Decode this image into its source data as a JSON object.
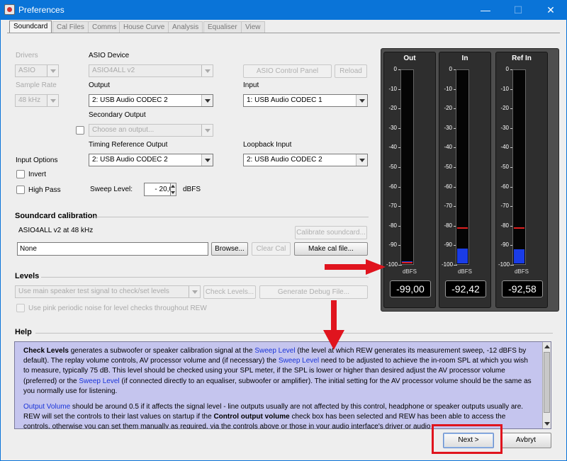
{
  "window": {
    "title": "Preferences",
    "minimize": "—",
    "maximize": "☐",
    "close": "✕"
  },
  "tabs": [
    "Soundcard",
    "Cal Files",
    "Comms",
    "House Curve",
    "Analysis",
    "Equaliser",
    "View"
  ],
  "drivers": {
    "label": "Drivers",
    "value": "ASIO"
  },
  "sample_rate": {
    "label": "Sample Rate",
    "value": "48 kHz"
  },
  "asio_device": {
    "label": "ASIO Device",
    "value": "ASIO4ALL v2"
  },
  "asio_control_panel": "ASIO Control Panel",
  "reload": "Reload",
  "output": {
    "label": "Output",
    "value": "2: USB Audio CODEC  2"
  },
  "input": {
    "label": "Input",
    "value": "1: USB Audio CODEC  1"
  },
  "secondary_output": {
    "label": "Secondary Output",
    "placeholder": "Choose an output..."
  },
  "timing_ref": {
    "label": "Timing Reference Output",
    "value": "2: USB Audio CODEC  2"
  },
  "loopback": {
    "label": "Loopback Input",
    "value": "2: USB Audio CODEC  2"
  },
  "input_options": {
    "label": "Input Options",
    "invert": "Invert",
    "high_pass": "High Pass"
  },
  "sweep": {
    "label": "Sweep Level:",
    "value": "- 20,0",
    "unit": "dBFS"
  },
  "calibration": {
    "title": "Soundcard calibration",
    "info": "ASIO4ALL v2 at 48 kHz",
    "calibrate": "Calibrate soundcard...",
    "file": "None",
    "browse": "Browse...",
    "clear": "Clear Cal",
    "make": "Make cal file..."
  },
  "levels": {
    "title": "Levels",
    "signal": "Use main speaker test signal to check/set levels",
    "check": "Check Levels...",
    "debug": "Generate Debug File...",
    "pink": "Use pink periodic noise for level checks throughout REW"
  },
  "meters": [
    {
      "title": "Out",
      "value": "-99,00",
      "peak_db": -99,
      "level_db": -99,
      "unit": "dBFS"
    },
    {
      "title": "In",
      "value": "-92,42",
      "peak_db": -81,
      "level_db": -92.42,
      "unit": "dBFS"
    },
    {
      "title": "Ref In",
      "value": "-92,58",
      "peak_db": -81,
      "level_db": -92.58,
      "unit": "dBFS"
    }
  ],
  "scale_ticks": [
    "0",
    "-10",
    "-20",
    "-30",
    "-40",
    "-50",
    "-60",
    "-70",
    "-80",
    "-90",
    "-100"
  ],
  "help": {
    "title": "Help",
    "p1": {
      "b1": "Check Levels",
      "t1": " generates a subwoofer or speaker calibration signal at the ",
      "l1": "Sweep Level",
      "t2": " (the level at which REW generates its measurement sweep, -12 dBFS by default). The replay volume controls, AV processor volume and (if necessary) the ",
      "l2": "Sweep Level",
      "t3": " need to be adjusted to achieve the in-room SPL at which you wish to measure, typically 75 dB. This level should be checked using your SPL meter, if the SPL is lower or higher than desired adjust the AV processor volume (preferred) or the ",
      "l3": "Sweep Level",
      "t4": " (if connected directly to an equaliser, subwoofer or amplifier). The initial setting for the AV processor volume should be the same as you normally use for listening."
    },
    "p2": {
      "l1": "Output Volume",
      "t1": " should be around 0.5 if it affects the signal level - line outputs usually are not affected by this control, headphone or speaker outputs usually are. REW will set the controls to their last values on startup if the ",
      "b1": "Control output volume",
      "t2": " check box has been selected and REW has been able to access the controls, otherwise you can set them manually as required, via the controls above or those in your audio interface's driver or audio"
    }
  },
  "buttons": {
    "next": "Next >",
    "cancel": "Avbryt"
  },
  "colors": {
    "title_bar": "#0a74d8",
    "meter_fill": "#1a3ce6",
    "peak": "#e02020",
    "help_bg": "#c5c5ee",
    "annotation": "#e0141e"
  }
}
